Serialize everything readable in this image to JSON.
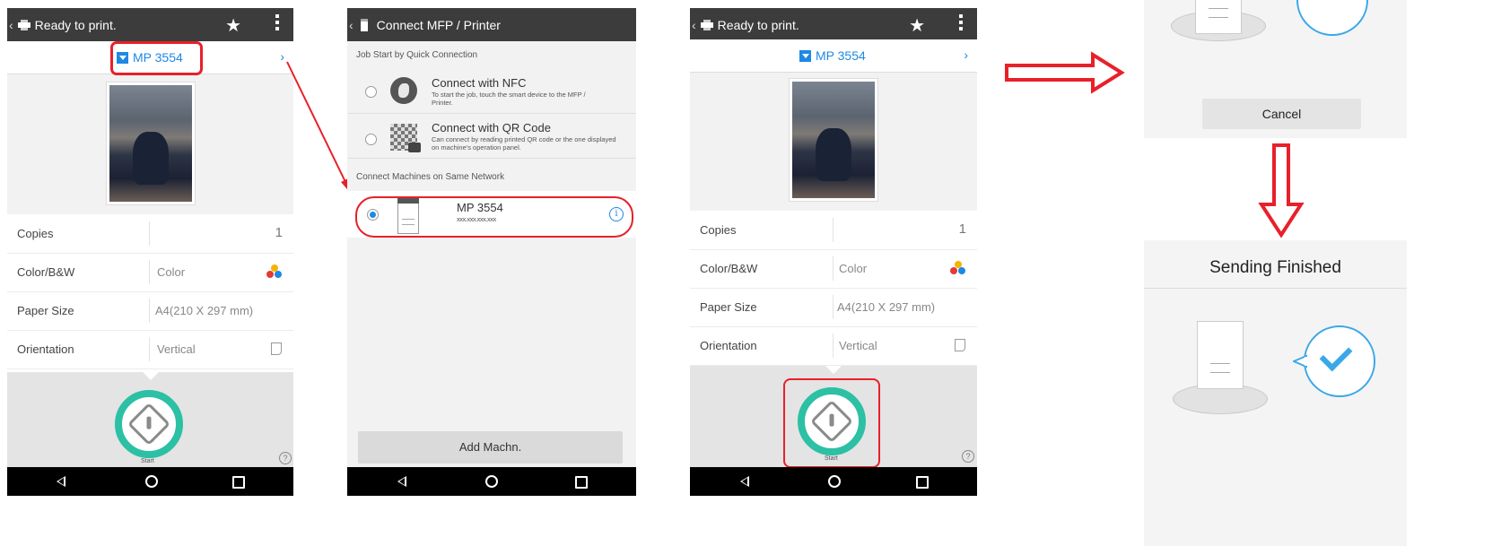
{
  "phone1": {
    "header_title": "Ready to print.",
    "device_name": "MP 3554",
    "settings": [
      {
        "label": "Copies",
        "value": "",
        "count": "1"
      },
      {
        "label": "Color/B&W",
        "value": "Color"
      },
      {
        "label": "Paper Size",
        "value": "A4(210 X 297 mm)"
      },
      {
        "label": "Orientation",
        "value": "Vertical"
      }
    ],
    "start_label": "Start",
    "help_glyph": "?"
  },
  "phone2": {
    "header_title": "Connect MFP / Printer",
    "section_quick": "Job Start by Quick Connection",
    "nfc_title": "Connect with NFC",
    "nfc_desc": "To start the job, touch the smart device to the MFP / Printer.",
    "qr_title": "Connect with QR Code",
    "qr_desc": "Can connect by reading printed QR code or the one displayed on machine's operation panel.",
    "section_network": "Connect Machines on Same Network",
    "machine_name": "MP 3554",
    "machine_ip": "xxx.xxx.xxx.xxx",
    "info_glyph": "i",
    "add_button": "Add Machn."
  },
  "phone3": {
    "header_title": "Ready to print.",
    "device_name": "MP 3554",
    "settings": [
      {
        "label": "Copies",
        "value": "",
        "count": "1"
      },
      {
        "label": "Color/B&W",
        "value": "Color"
      },
      {
        "label": "Paper Size",
        "value": "A4(210 X 297 mm)"
      },
      {
        "label": "Orientation",
        "value": "Vertical"
      }
    ],
    "start_label": "Start",
    "help_glyph": "?"
  },
  "panel_sending": {
    "cancel_label": "Cancel"
  },
  "panel_finished": {
    "title": "Sending Finished"
  },
  "colors": {
    "accent_blue": "#1e88e5",
    "start_teal": "#2cc0a4",
    "highlight_red": "#e8202a",
    "bubble_blue": "#3aa8e8"
  }
}
